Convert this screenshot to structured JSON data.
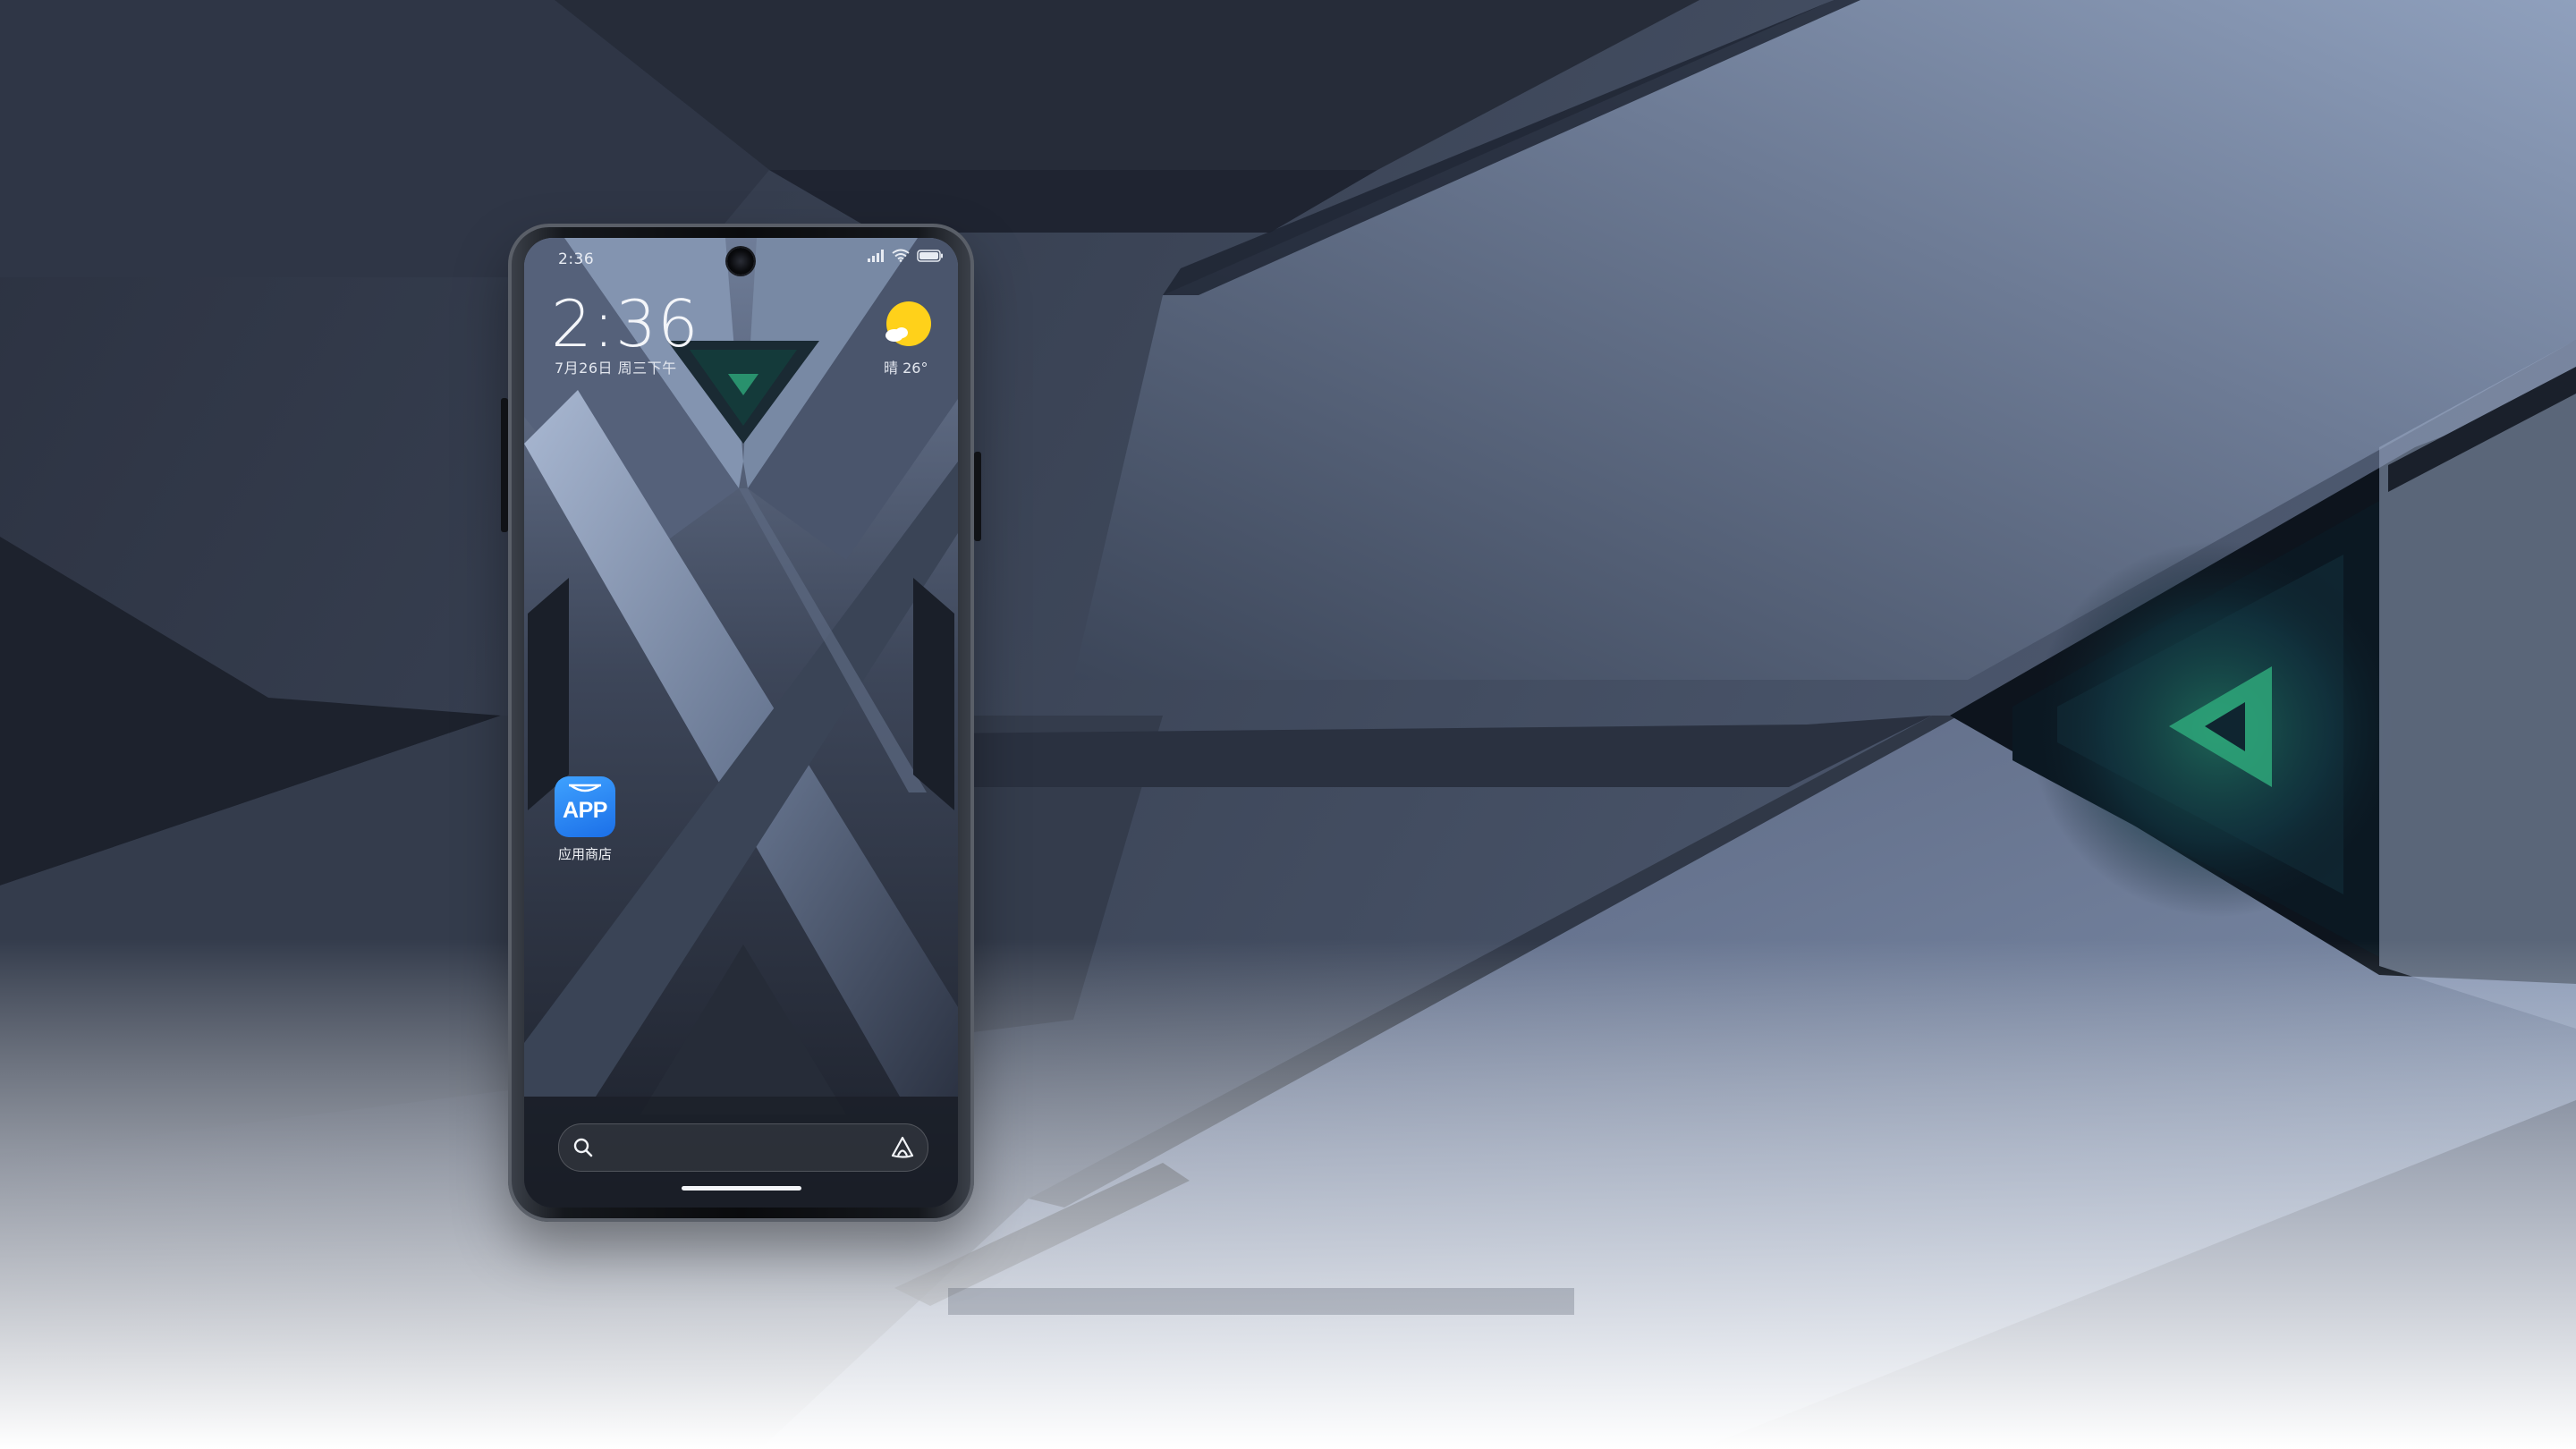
{
  "status_bar": {
    "time": "2:36"
  },
  "clock_widget": {
    "time": "2:36",
    "date": "7月26日 周三下午"
  },
  "weather_widget": {
    "icon": "sunny-icon",
    "text": "晴 26°"
  },
  "apps": [
    {
      "icon_text": "APP",
      "label": "应用商店",
      "icon": "app-store-icon"
    }
  ],
  "search_bar": {
    "left_icon": "search-icon",
    "right_icon": "assistant-icon"
  },
  "colors": {
    "app_icon_blue": "#1b6fe8",
    "weather_sun": "#ffd11a",
    "accent_green": "#2ea77a"
  }
}
